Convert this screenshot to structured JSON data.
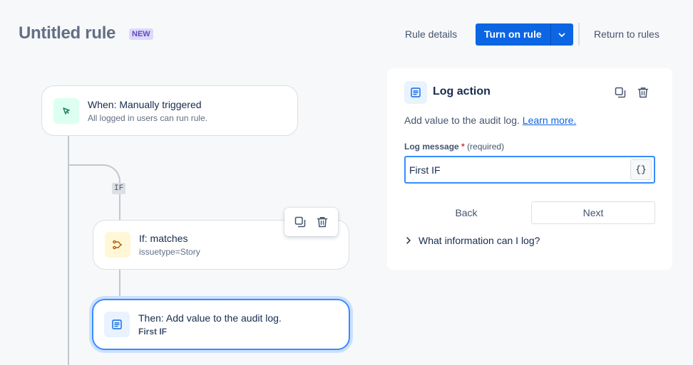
{
  "header": {
    "title": "Untitled rule",
    "badge": "NEW",
    "rule_details_label": "Rule details",
    "turn_on_label": "Turn on rule",
    "return_label": "Return to rules"
  },
  "flow": {
    "trigger": {
      "title": "When: Manually triggered",
      "subtitle": "All logged in users can run rule.",
      "icon": "cursor-click-icon"
    },
    "branch_label": "IF",
    "condition": {
      "title": "If: matches",
      "subtitle": "issuetype=Story",
      "icon": "branch-icon"
    },
    "action": {
      "title": "Then: Add value to the audit log.",
      "subtitle": "First IF",
      "icon": "document-icon"
    }
  },
  "panel": {
    "title": "Log action",
    "description": "Add value to the audit log.",
    "learn_more": "Learn more.",
    "field_label": "Log message",
    "field_required_mark": "*",
    "field_hint": "(required)",
    "field_value": "First IF",
    "smart_value_button": "{}",
    "back_label": "Back",
    "next_label": "Next",
    "expander_label": "What information can I log?"
  },
  "colors": {
    "primary": "#0c66e4",
    "selected_border": "#388bff",
    "trigger_bg": "#dcfff1",
    "condition_bg": "#fff7d6",
    "action_bg": "#e9f2ff"
  }
}
